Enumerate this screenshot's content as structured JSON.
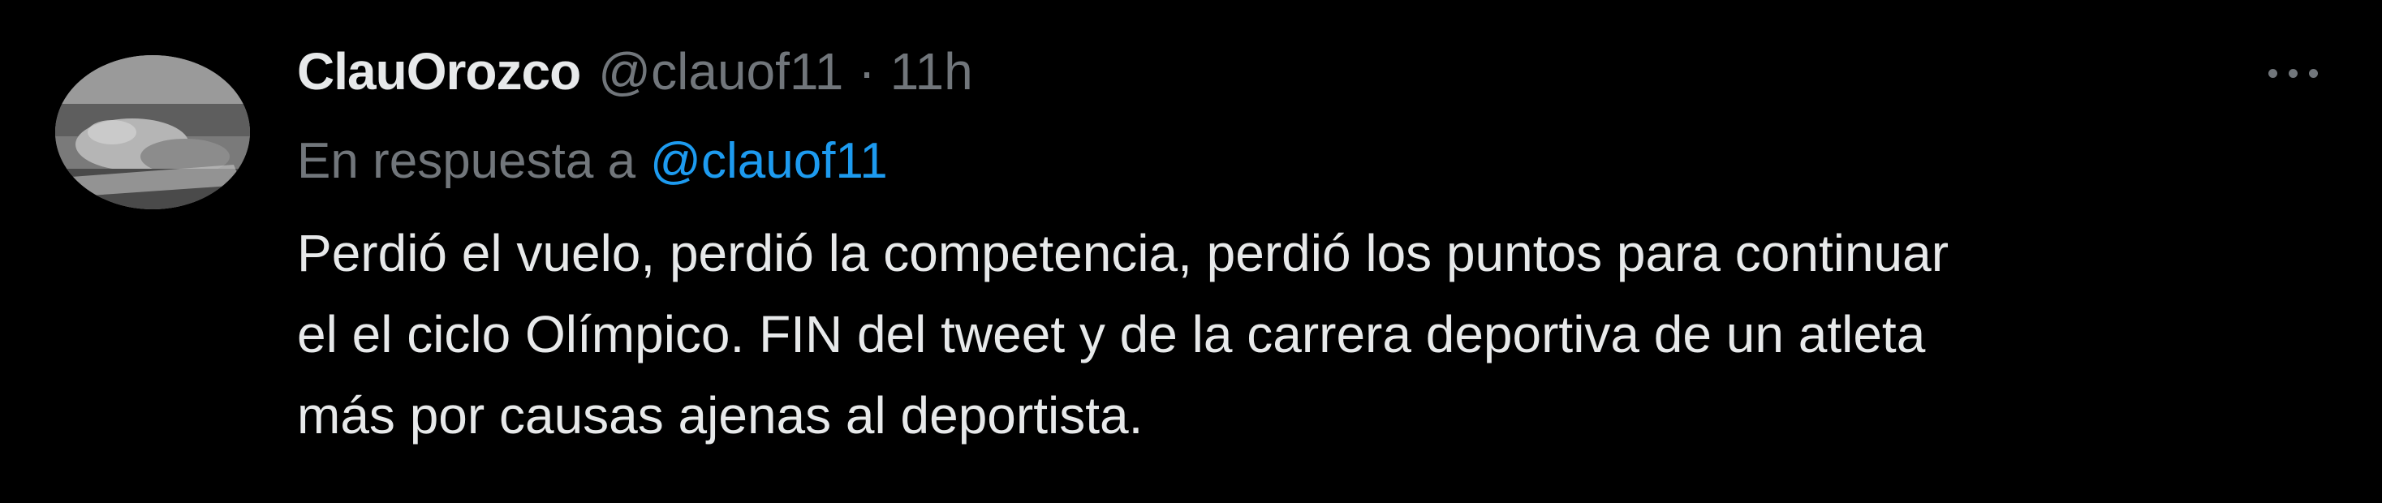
{
  "tweet": {
    "display_name": "ClauOrozco",
    "handle": "@clauof11",
    "separator": "·",
    "time": "11h",
    "more_icon": "more-horizontal-icon",
    "reply_prefix": "En respuesta a",
    "reply_to": "@clauof11",
    "text_lines": [
      "Perdió el vuelo, perdió la competencia, perdió los puntos para continuar",
      "el el ciclo Olímpico.  FIN del tweet y de la carrera deportiva de un atleta",
      "más por causas ajenas al deportista."
    ]
  },
  "colors": {
    "background": "#000000",
    "primary_text": "#e7e9ea",
    "secondary_text": "#71767b",
    "link": "#1d9bf0"
  }
}
